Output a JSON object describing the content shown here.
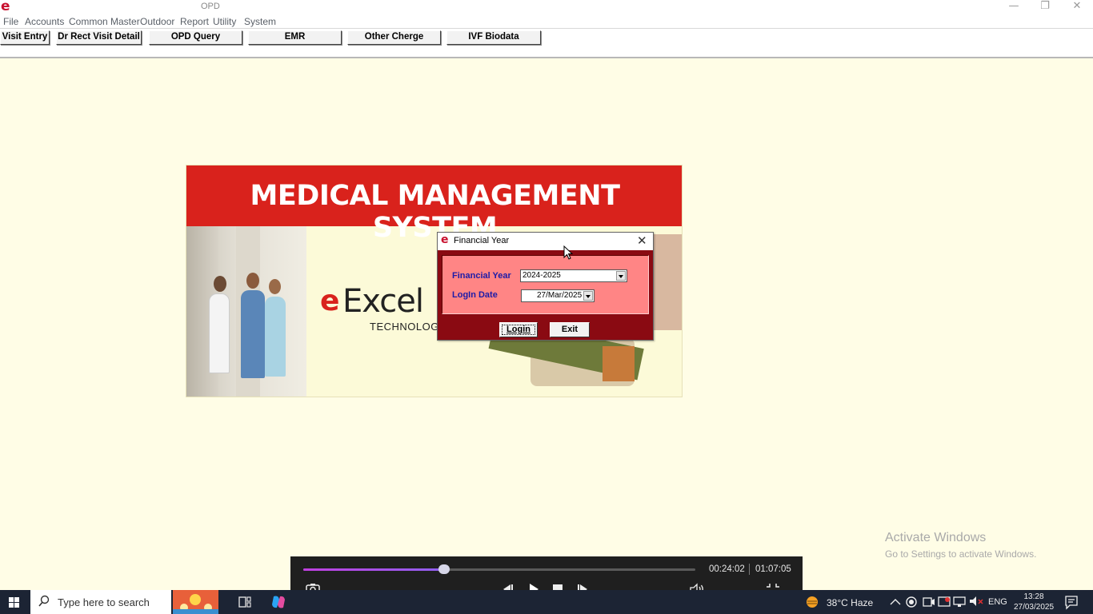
{
  "window": {
    "title": "OPD",
    "logo_glyph": "e",
    "controls": {
      "minimize": "—",
      "restore": "❐",
      "close": "✕"
    }
  },
  "menu": [
    "File",
    "Accounts",
    "Common Master",
    "Outdoor",
    "Report",
    "Utility",
    "System"
  ],
  "toolbar": [
    "Visit Entry",
    "Dr Rect Visit Detail",
    "OPD Query",
    "EMR",
    "Other Cherge",
    "IVF Biodata"
  ],
  "splash": {
    "title": "MEDICAL MANAGEMENT SYSTEM",
    "logo_mark": "e",
    "logo_word": "Excel",
    "logo_sub": "TECHNOLOGIES"
  },
  "dialog": {
    "title": "Financial Year",
    "close_glyph": "✕",
    "financial_year_label": "Financial Year",
    "financial_year_value": "2024-2025",
    "login_date_label": "LogIn Date",
    "login_date_value": "27/Mar/2025",
    "login_button": "Login",
    "exit_button": "Exit"
  },
  "watermark": {
    "line1": "Activate Windows",
    "line2": "Go to Settings to activate Windows."
  },
  "player": {
    "current_time": "00:24:02",
    "total_time": "01:07:05",
    "progress": 0.36,
    "icons": [
      "camera-icon",
      "previous-icon",
      "play-icon",
      "stop-icon",
      "next-icon",
      "volume-icon",
      "exit-fullscreen-icon"
    ]
  },
  "taskbar": {
    "search_placeholder": "Type here to search",
    "weather": "38°C  Haze",
    "language": "ENG",
    "time": "13:28",
    "date": "27/03/2025"
  }
}
